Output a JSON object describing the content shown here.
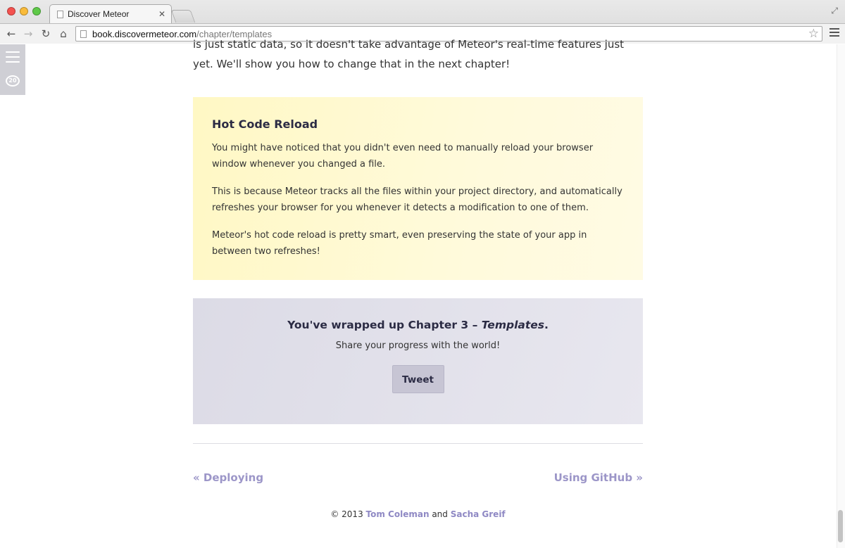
{
  "browser": {
    "tab_title": "Discover Meteor",
    "tab_close": "✕",
    "url_host": "book.discovermeteor.com",
    "url_path": "/chapter/templates"
  },
  "sidebar": {
    "comments_count": "20"
  },
  "article": {
    "intro_text": "is just static data, so it doesn't take advantage of Meteor's real-time features just yet. We'll show you how to change that in the next chapter!",
    "note": {
      "title": "Hot Code Reload",
      "paragraphs": [
        "You might have noticed that you didn't even need to manually reload your browser window whenever you changed a file.",
        "This is because Meteor tracks all the files within your project directory, and automatically refreshes your browser for you whenever it detects a modification to one of them.",
        "Meteor's hot code reload is pretty smart, even preserving the state of your app in between two refreshes!"
      ]
    },
    "share": {
      "heading_prefix": "You've wrapped up Chapter 3 – ",
      "heading_chapter": "Templates",
      "heading_suffix": ".",
      "subtext": "Share your progress with the world!",
      "tweet_label": "Tweet"
    }
  },
  "pagination": {
    "prev_label": "« Deploying",
    "next_label": "Using GitHub »"
  },
  "footer": {
    "copyright": "© 2013",
    "author1": "Tom Coleman",
    "conjunction": "and",
    "author2": "Sacha Greif"
  },
  "colors": {
    "link": "#9c96c8",
    "note_bg": "#fff8c4",
    "share_bg": "#e2e1ea"
  }
}
